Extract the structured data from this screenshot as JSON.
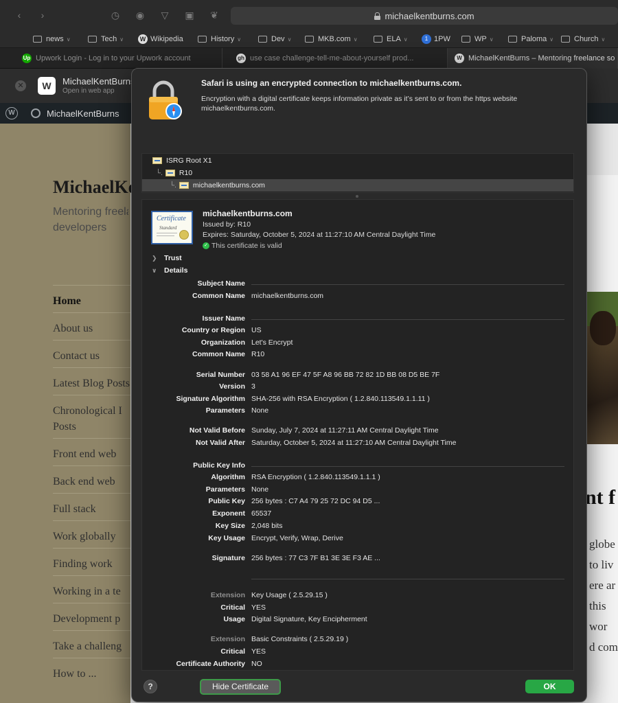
{
  "browser": {
    "url": "michaelkentburns.com",
    "bookmarks": [
      {
        "label": "news",
        "kind": "folder"
      },
      {
        "label": "Tech",
        "kind": "folder"
      },
      {
        "label": "Wikipedia",
        "kind": "wp"
      },
      {
        "label": "History",
        "kind": "folder"
      },
      {
        "label": "Dev",
        "kind": "folder"
      },
      {
        "label": "MKB.com",
        "kind": "folder"
      },
      {
        "label": "ELA",
        "kind": "folder"
      },
      {
        "label": "1PW",
        "kind": "onepw"
      },
      {
        "label": "WP",
        "kind": "folder"
      },
      {
        "label": "Paloma",
        "kind": "folder"
      },
      {
        "label": "Church",
        "kind": "folder"
      }
    ],
    "tabs": [
      {
        "label": "Upwork Login - Log in to your Upwork account",
        "favicon": "Up",
        "color": "#14a800"
      },
      {
        "label": "use case challenge-tell-me-about-yourself prod...",
        "favicon": "gh",
        "color": "#dddddd"
      },
      {
        "label": "MichaelKentBurns – Mentoring freelance so",
        "favicon": "W",
        "color": "#dddddd"
      }
    ]
  },
  "webapp_banner": {
    "title": "MichaelKentBurns",
    "subtitle": "Open in web app"
  },
  "wp_admin": {
    "site_name": "MichaelKentBurns"
  },
  "page": {
    "title": "MichaelKentBurns",
    "tagline_1": "Mentoring freelance",
    "tagline_2": "developers",
    "nav": [
      "Home",
      "About us",
      "Contact us",
      "Latest Blog Posts",
      "Chronological I",
      "Posts",
      "Front end web",
      "Back end web",
      "Full stack",
      "Work globally",
      "Finding work",
      "Working in a te",
      "Development p",
      "Take a challeng",
      "How to ..."
    ],
    "heading_fragment": "nt f",
    "right_lines": [
      "globe",
      "to liv",
      "ere ar",
      "this",
      "wor",
      "d com"
    ]
  },
  "dialog": {
    "headline": "Safari is using an encrypted connection to michaelkentburns.com.",
    "description": "Encryption with a digital certificate keeps information private as it’s sent to or from the https website michaelkentburns.com.",
    "chain": [
      "ISRG Root X1",
      "R10",
      "michaelkentburns.com"
    ],
    "cert": {
      "name": "michaelkentburns.com",
      "issued_by": "Issued by: R10",
      "expires": "Expires: Saturday, October 5, 2024 at 11:27:10 AM Central Daylight Time",
      "valid": "This certificate is valid",
      "image_title": "Certificate",
      "image_sub": "Standard"
    },
    "trust_label": "Trust",
    "details_label": "Details",
    "details": [
      {
        "label": "Subject Name",
        "value": "",
        "rule": true
      },
      {
        "label": "Common Name",
        "value": "michaelkentburns.com"
      },
      {
        "label": "Issuer Name",
        "value": "",
        "rule": true
      },
      {
        "label": "Country or Region",
        "value": "US"
      },
      {
        "label": "Organization",
        "value": "Let's Encrypt"
      },
      {
        "label": "Common Name",
        "value": "R10"
      },
      {
        "label": "Serial Number",
        "value": "03 58 A1 96 EF 47 5F A8 96 BB 72 82 1D BB 08 D5 BE 7F"
      },
      {
        "label": "Version",
        "value": "3"
      },
      {
        "label": "Signature Algorithm",
        "value": "SHA-256 with RSA Encryption ( 1.2.840.113549.1.1.11 )"
      },
      {
        "label": "Parameters",
        "value": "None"
      },
      {
        "label": "Not Valid Before",
        "value": "Sunday, July 7, 2024 at 11:27:11 AM Central Daylight Time"
      },
      {
        "label": "Not Valid After",
        "value": "Saturday, October 5, 2024 at 11:27:10 AM Central Daylight Time"
      },
      {
        "label": "Public Key Info",
        "value": "",
        "rule": true
      },
      {
        "label": "Algorithm",
        "value": "RSA Encryption ( 1.2.840.113549.1.1.1 )"
      },
      {
        "label": "Parameters",
        "value": "None"
      },
      {
        "label": "Public Key",
        "value": "256 bytes : C7 A4 79 25 72 DC 94 D5 ..."
      },
      {
        "label": "Exponent",
        "value": "65537"
      },
      {
        "label": "Key Size",
        "value": "2,048 bits"
      },
      {
        "label": "Key Usage",
        "value": "Encrypt, Verify, Wrap, Derive"
      },
      {
        "label": "Signature",
        "value": "256 bytes : 77 C3 7F B1 3E 3E F3 AE ..."
      },
      {
        "label": "Extension",
        "value": "Key Usage ( 2.5.29.15 )",
        "dim": true
      },
      {
        "label": "Critical",
        "value": "YES"
      },
      {
        "label": "Usage",
        "value": "Digital Signature, Key Encipherment"
      },
      {
        "label": "Extension",
        "value": "Basic Constraints ( 2.5.29.19 )",
        "dim": true
      },
      {
        "label": "Critical",
        "value": "YES"
      },
      {
        "label": "Certificate Authority",
        "value": "NO"
      }
    ],
    "help_label": "?",
    "hide_cert_label": "Hide Certificate",
    "ok_label": "OK"
  }
}
